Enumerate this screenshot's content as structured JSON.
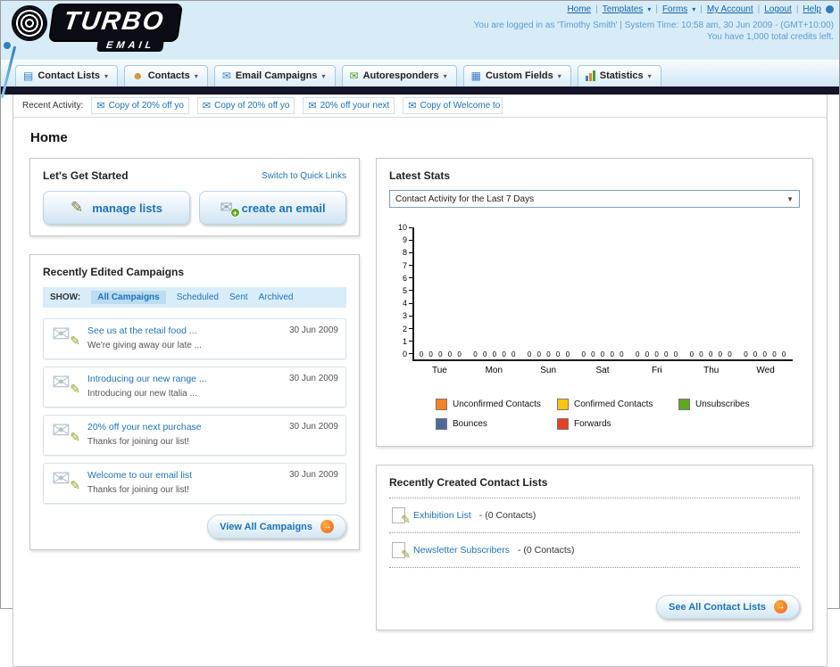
{
  "header": {
    "logo_main": "TURBO",
    "logo_sub": "EMAIL",
    "nav": {
      "home": "Home",
      "templates": "Templates",
      "forms": "Forms",
      "my_account": "My Account",
      "logout": "Logout",
      "help": "Help"
    },
    "login_info": "You are logged in as 'Timothy Smith' | System Time: 10:58 am, 30 Jun 2009 - (GMT+10:00)",
    "credits_info": "You have 1,000 total credits left."
  },
  "nav_tabs": [
    {
      "label": "Contact Lists"
    },
    {
      "label": "Contacts"
    },
    {
      "label": "Email Campaigns"
    },
    {
      "label": "Autoresponders"
    },
    {
      "label": "Custom Fields"
    },
    {
      "label": "Statistics"
    }
  ],
  "recent_activity": {
    "label": "Recent Activity:",
    "items": [
      {
        "text": "Copy of 20% off yo"
      },
      {
        "text": "Copy of 20% off yo"
      },
      {
        "text": "20% off your next"
      },
      {
        "text": "Copy of Welcome to"
      }
    ]
  },
  "page": {
    "title": "Home"
  },
  "get_started": {
    "title": "Let's Get Started",
    "switch_link": "Switch to Quick Links",
    "manage_lists_label": "manage lists",
    "create_email_label": "create an email"
  },
  "campaigns": {
    "title": "Recently Edited Campaigns",
    "show_label": "SHOW:",
    "filters": [
      {
        "label": "All Campaigns"
      },
      {
        "label": "Scheduled"
      },
      {
        "label": "Sent"
      },
      {
        "label": "Archived"
      }
    ],
    "items": [
      {
        "title": "See us at the retail food ...",
        "subtitle": "We're giving away our late ...",
        "date": "30 Jun 2009"
      },
      {
        "title": "Introducing our new range ...",
        "subtitle": "Introducing our new Italia ...",
        "date": "30 Jun 2009"
      },
      {
        "title": "20% off your next purchase",
        "subtitle": "Thanks for joining our list!",
        "date": "30 Jun 2009"
      },
      {
        "title": "Welcome to our email list",
        "subtitle": "Thanks for joining our list!",
        "date": "30 Jun 2009"
      }
    ],
    "view_all_label": "View All Campaigns"
  },
  "stats": {
    "title": "Latest Stats",
    "selected_option": "Contact Activity for the Last 7 Days",
    "chart_data": {
      "type": "bar",
      "title": "Contact Activity for the Last 7 Days",
      "categories": [
        "Tue",
        "Mon",
        "Sun",
        "Sat",
        "Fri",
        "Thu",
        "Wed"
      ],
      "series": [
        {
          "name": "Unconfirmed Contacts",
          "color": "#f5821f",
          "values": [
            0,
            0,
            0,
            0,
            0,
            0,
            0
          ]
        },
        {
          "name": "Confirmed Contacts",
          "color": "#fdc50d",
          "values": [
            0,
            0,
            0,
            0,
            0,
            0,
            0
          ]
        },
        {
          "name": "Unsubscribes",
          "color": "#5ea81d",
          "values": [
            0,
            0,
            0,
            0,
            0,
            0,
            0
          ]
        },
        {
          "name": "Bounces",
          "color": "#50699b",
          "values": [
            0,
            0,
            0,
            0,
            0,
            0,
            0
          ]
        },
        {
          "name": "Forwards",
          "color": "#e2431e",
          "values": [
            0,
            0,
            0,
            0,
            0,
            0,
            0
          ]
        }
      ],
      "ylim": [
        0,
        10
      ],
      "grid": false,
      "legend_position": "bottom"
    }
  },
  "contact_lists": {
    "title": "Recently Created Contact Lists",
    "items": [
      {
        "name": "Exhibition List",
        "detail": "- (0 Contacts)"
      },
      {
        "name": "Newsletter Subscribers",
        "detail": "- (0 Contacts)"
      }
    ],
    "see_all_label": "See All Contact Lists"
  }
}
